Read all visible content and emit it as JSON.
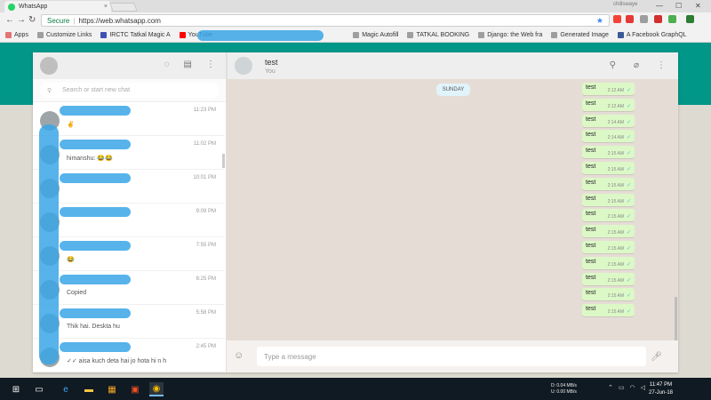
{
  "browser": {
    "tab_title": "WhatsApp",
    "tab_close": "×",
    "user_label": "chillswaye",
    "secure_label": "Secure",
    "url": "https://web.whatsapp.com",
    "nav": {
      "back": "←",
      "forward": "→",
      "reload": "↻",
      "star": "★"
    },
    "window_controls": {
      "minimize": "—",
      "maximize": "☐",
      "close": "✕"
    },
    "bookmarks": [
      {
        "label": "Apps",
        "icon_color": "#e57373"
      },
      {
        "label": "Customize Links",
        "icon_color": "#9e9e9e"
      },
      {
        "label": "IRCTC Tatkal Magic A",
        "icon_color": "#3f51b5"
      },
      {
        "label": "YouTube",
        "icon_color": "#ff0000"
      },
      {
        "label": "Magic Autofill",
        "icon_color": "#9e9e9e"
      },
      {
        "label": "TATKAL BOOKING",
        "icon_color": "#9e9e9e"
      },
      {
        "label": "Django: the Web fra",
        "icon_color": "#9e9e9e"
      },
      {
        "label": "Generated Image",
        "icon_color": "#9e9e9e"
      },
      {
        "label": "A Facebook GraphQL",
        "icon_color": "#3b5998"
      }
    ]
  },
  "sidebar": {
    "search_placeholder": "Search or start new chat",
    "icons": [
      "status-icon",
      "new-chat-icon",
      "menu-icon"
    ],
    "chats": [
      {
        "time": "11:23 PM",
        "preview": "✌"
      },
      {
        "time": "11:02 PM",
        "preview": "himanshu: 😂😂"
      },
      {
        "time": "10:01 PM",
        "preview": ""
      },
      {
        "time": "9:09 PM",
        "preview": ""
      },
      {
        "time": "7:55 PM",
        "preview": "😂"
      },
      {
        "time": "6:25 PM",
        "preview": "Copied"
      },
      {
        "time": "5:58 PM",
        "preview": "Thik hai. Deskta hu"
      },
      {
        "time": "2:45 PM",
        "preview": "✓✓ aisa kuch deta hai jo hota hi n h"
      }
    ]
  },
  "conversation": {
    "name": "test",
    "subtitle": "You",
    "day_label": "SUNDAY",
    "messages": [
      {
        "text": "test",
        "time": "2:12 AM"
      },
      {
        "text": "test",
        "time": "2:12 AM"
      },
      {
        "text": "test",
        "time": "2:14 AM"
      },
      {
        "text": "test",
        "time": "2:14 AM"
      },
      {
        "text": "test",
        "time": "2:15 AM"
      },
      {
        "text": "test",
        "time": "2:15 AM"
      },
      {
        "text": "test",
        "time": "2:15 AM"
      },
      {
        "text": "test",
        "time": "2:15 AM"
      },
      {
        "text": "test",
        "time": "2:15 AM"
      },
      {
        "text": "test",
        "time": "2:15 AM"
      },
      {
        "text": "test",
        "time": "2:15 AM"
      },
      {
        "text": "test",
        "time": "2:15 AM"
      },
      {
        "text": "test",
        "time": "2:15 AM"
      },
      {
        "text": "test",
        "time": "2:15 AM"
      },
      {
        "text": "test",
        "time": "2:15 AM"
      }
    ],
    "composer_placeholder": "Type a message"
  },
  "taskbar": {
    "net_down_label": "D:",
    "net_down": "0.04 MB/s",
    "net_up_label": "U:",
    "net_up": "0.00 MB/s",
    "time": "11:47 PM",
    "date": "27-Jun-18"
  },
  "colors": {
    "teal_header": "#009688",
    "outgoing_bubble": "#dcf8c6",
    "redaction_blue": "#3aa6e6"
  }
}
